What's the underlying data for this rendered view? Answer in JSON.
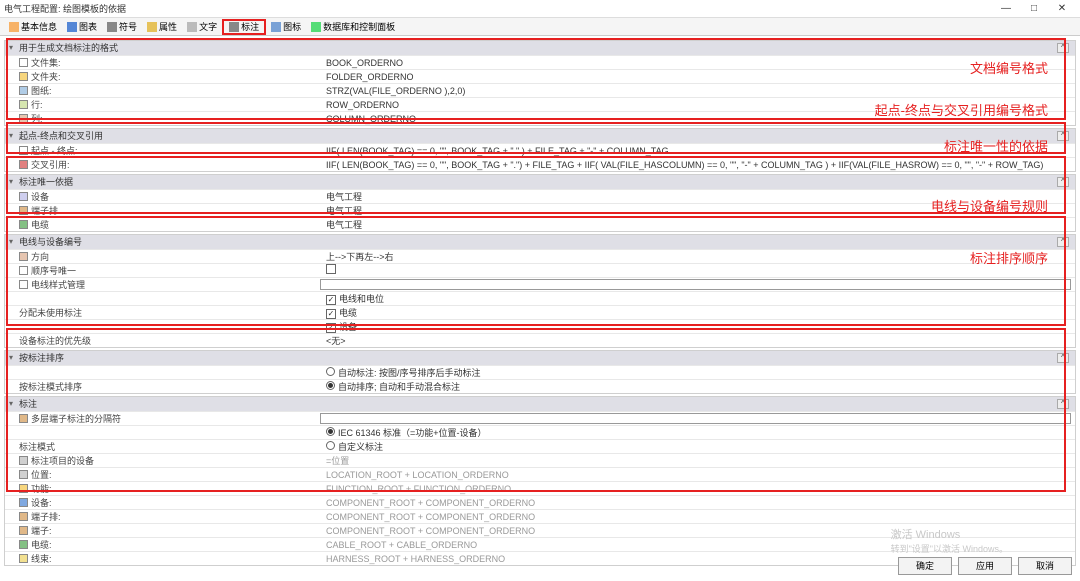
{
  "window": {
    "title": "电气工程配置: 绘图模板的依据"
  },
  "ctrls": {
    "min": "—",
    "max": "□",
    "close": "✕"
  },
  "toolbar": [
    {
      "label": "基本信息"
    },
    {
      "label": "图表"
    },
    {
      "label": "符号"
    },
    {
      "label": "属性"
    },
    {
      "label": "文字"
    },
    {
      "label": "标注",
      "active": true
    },
    {
      "label": "图标"
    },
    {
      "label": "数据库和控制面板"
    }
  ],
  "sec1": {
    "title": "用于生成文档标注的格式",
    "rows": [
      {
        "lbl": "文件集:",
        "val": "BOOK_ORDERNO",
        "ico": "doc"
      },
      {
        "lbl": "文件夹:",
        "val": "FOLDER_ORDERNO",
        "ico": "fld"
      },
      {
        "lbl": "图纸:",
        "val": "STRZ(VAL(FILE_ORDERNO ),2,0)",
        "ico": "img2"
      },
      {
        "lbl": "行:",
        "val": "ROW_ORDERNO",
        "ico": "row2"
      },
      {
        "lbl": "列:",
        "val": "COLUMN_ORDERNO",
        "ico": "col2"
      }
    ]
  },
  "sec2": {
    "title": "起点-终点和交叉引用",
    "rows": [
      {
        "lbl": "起点 - 终点:",
        "val": "IIF( LEN(BOOK_TAG) == 0, \"\", BOOK_TAG + \".\" ) + FILE_TAG + \"-\" + COLUMN_TAG",
        "ico": "doc"
      },
      {
        "lbl": "交叉引用:",
        "val": "IIF( LEN(BOOK_TAG) == 0, \"\", BOOK_TAG + \".\") + FILE_TAG + IIF( VAL(FILE_HASCOLUMN) == 0, \"\", \"-\" + COLUMN_TAG ) + IIF(VAL(FILE_HASROW) == 0, \"\", \"-\" + ROW_TAG)",
        "ico": "red"
      }
    ]
  },
  "sec3": {
    "title": "标注唯一依据",
    "rows": [
      {
        "lbl": "设备",
        "val": "电气工程",
        "ico": "dev"
      },
      {
        "lbl": "端子排",
        "val": "电气工程",
        "ico": "term"
      },
      {
        "lbl": "电缆",
        "val": "电气工程",
        "ico": "cab"
      }
    ]
  },
  "sec4": {
    "title": "电线与设备编号",
    "dir": {
      "lbl": "方向",
      "val": "上-->下再左-->右",
      "ico": "col2"
    },
    "ord": {
      "lbl": "顺序号唯一"
    },
    "wire": {
      "lbl": "电线样式管理"
    },
    "alloc_lbl": "分配未使用标注",
    "opts": [
      {
        "cb": true,
        "txt": "电线和电位"
      },
      {
        "cb": true,
        "txt": "电缆"
      },
      {
        "cb": true,
        "txt": "设备"
      }
    ],
    "prio": {
      "lbl": "设备标注的优先级",
      "val": "<无>"
    }
  },
  "sec5": {
    "title": "按标注排序",
    "lbl": "按标注模式排序",
    "opt1": "自动标注: 按图/序号排序后手动标注",
    "opt2": "自动排序; 自动和手动混合标注"
  },
  "sec6": {
    "title": "标注",
    "multi": {
      "lbl": "多层端子标注的分隔符",
      "ico": "term"
    },
    "mode_lbl": "标注模式",
    "mode1": "IEC 61346 标准（=功能+位置-设备）",
    "mode2": "自定义标注",
    "rows": [
      {
        "lbl": "标注项目的设备",
        "val": "=位置",
        "ico": "loc"
      },
      {
        "lbl": "位置:",
        "val": "LOCATION_ROOT + LOCATION_ORDERNO",
        "ico": "loc"
      },
      {
        "lbl": "功能:",
        "val": "FUNCTION_ROOT + FUNCTION_ORDERNO",
        "ico": "fld"
      },
      {
        "lbl": "设备:",
        "val": "COMPONENT_ROOT + COMPONENT_ORDERNO",
        "ico": "cabblue"
      },
      {
        "lbl": "端子排:",
        "val": "COMPONENT_ROOT + COMPONENT_ORDERNO",
        "ico": "term"
      },
      {
        "lbl": "端子:",
        "val": "COMPONENT_ROOT + COMPONENT_ORDERNO",
        "ico": "term"
      },
      {
        "lbl": "电缆:",
        "val": "CABLE_ROOT + CABLE_ORDERNO",
        "ico": "cab"
      },
      {
        "lbl": "线束:",
        "val": "HARNESS_ROOT + HARNESS_ORDERNO",
        "ico": "src"
      }
    ]
  },
  "annots": {
    "a1": "文档编号格式",
    "a2": "起点-终点与交叉引用编号格式",
    "a3": "标注唯一性的依据",
    "a4": "电线与设备编号规则",
    "a5": "标注排序顺序"
  },
  "footer": {
    "ok": "确定",
    "apply": "应用",
    "cancel": "取消"
  },
  "watermark": {
    "t1": "激活 Windows",
    "t2": "转到\"设置\"以激活 Windows。"
  }
}
